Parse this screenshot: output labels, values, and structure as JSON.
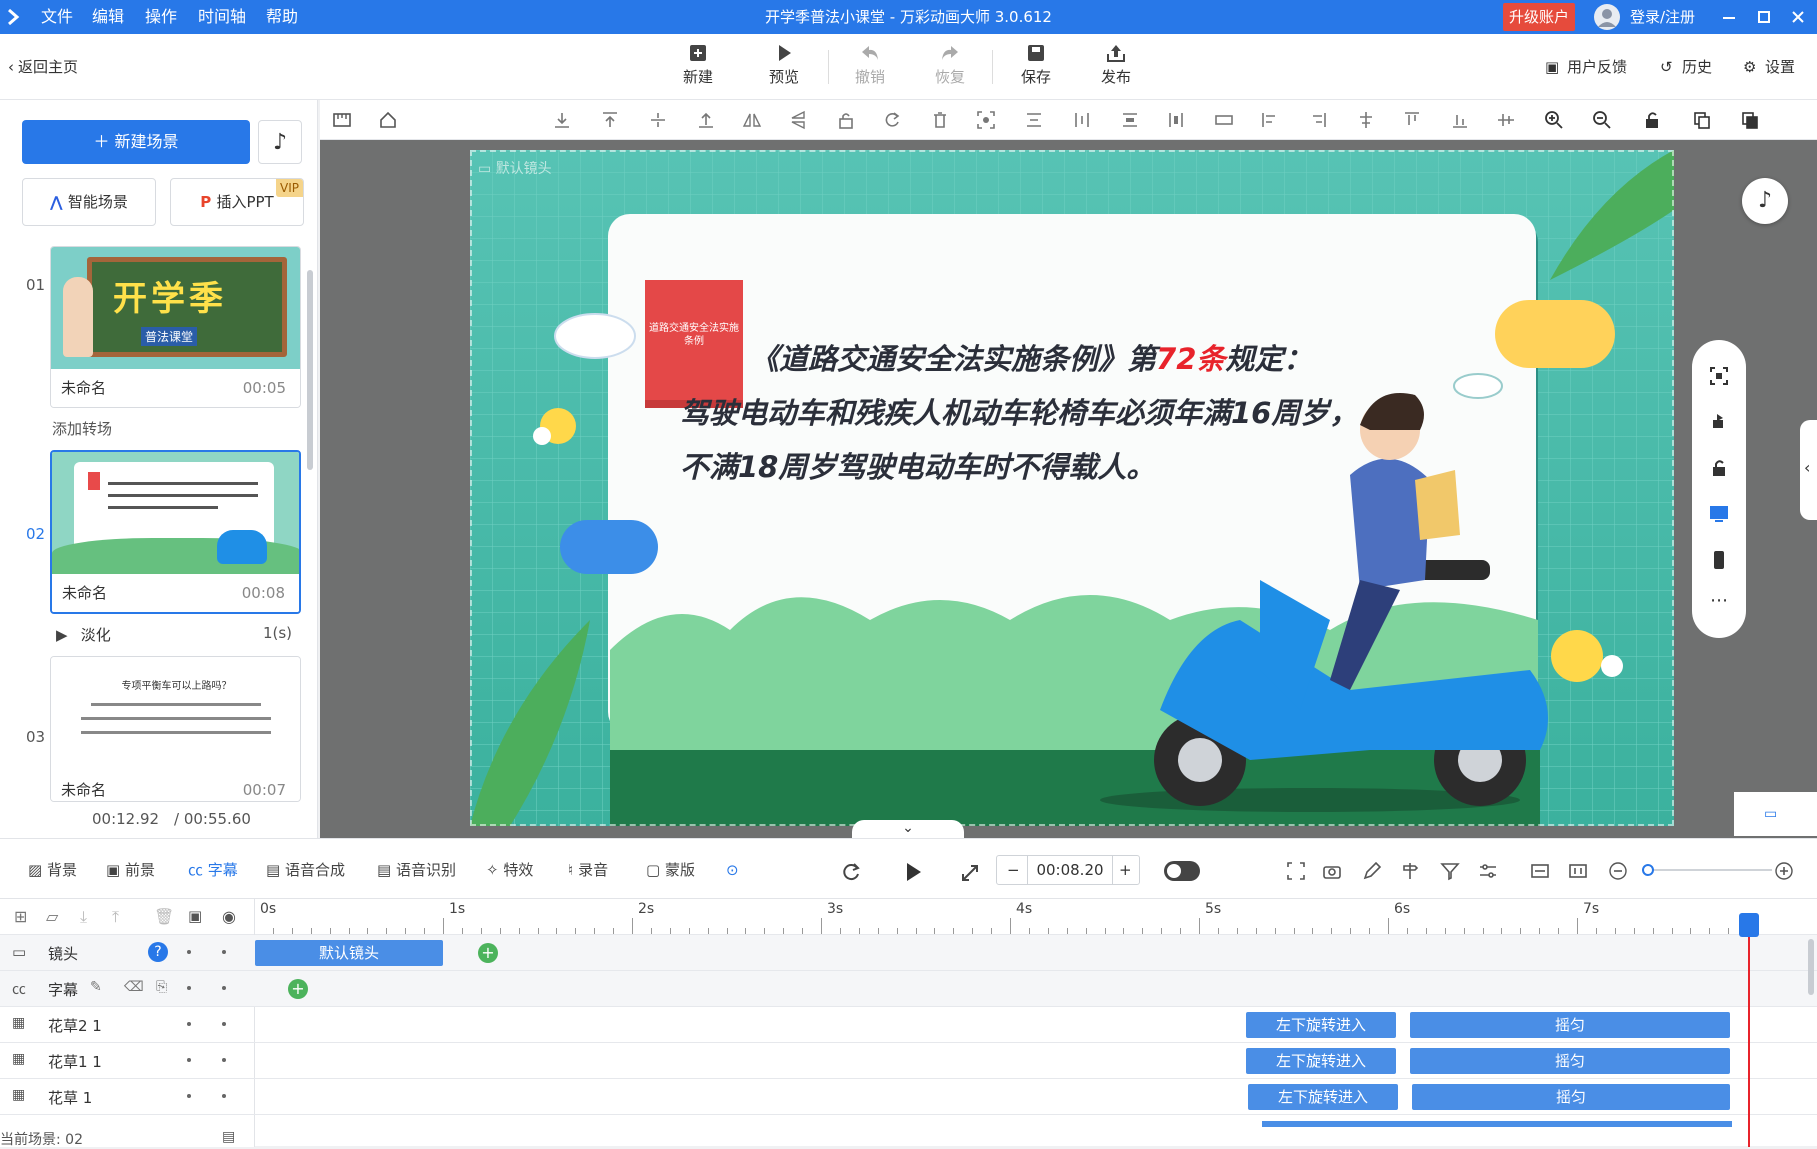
{
  "app": {
    "title": "开学季普法小课堂 - 万彩动画大师 3.0.612",
    "menu": [
      "文件",
      "编辑",
      "操作",
      "时间轴",
      "帮助"
    ],
    "upgrade": "升级账户",
    "login": "登录/注册"
  },
  "toolbar": {
    "back": "返回主页",
    "new": "新建",
    "preview": "预览",
    "undo": "撤销",
    "redo": "恢复",
    "save": "保存",
    "publish": "发布",
    "feedback": "用户反馈",
    "history": "历史",
    "settings": "设置"
  },
  "left": {
    "new_scene": "新建场景",
    "smart_scene": "智能场景",
    "insert_ppt": "插入PPT",
    "vip": "VIP",
    "add_transition": "添加转场",
    "transition_name": "淡化",
    "transition_dur": "1(s)",
    "current_time": "00:12.92",
    "total_time": "/ 00:55.60",
    "scenes": [
      {
        "num": "01",
        "name": "未命名",
        "dur": "00:05",
        "thumb_text": "开学季",
        "thumb_sub": "普法课堂"
      },
      {
        "num": "02",
        "name": "未命名",
        "dur": "00:08"
      },
      {
        "num": "03",
        "name": "未命名",
        "dur": "00:07",
        "thumb_text": "专项平衡车可以上路吗？"
      }
    ]
  },
  "stage": {
    "camera_label": "默认镜头",
    "book_text": "道路交通安全法实施条例",
    "line1_pre": "《道路交通安全法实施条例》第",
    "line1_num": "72条",
    "line1_post": "规定：",
    "line2": "驾驶电动车和残疾人机动车轮椅车必须年满16周岁，",
    "line3": "不满18周岁驾驶电动车时不得载人。"
  },
  "bottombar": {
    "tabs": [
      "背景",
      "前景",
      "字幕",
      "语音合成",
      "语音识别",
      "特效",
      "录音",
      "蒙版"
    ],
    "time": "00:08.20",
    "minus": "−",
    "plus": "+"
  },
  "timeline": {
    "ruler": [
      "0s",
      "1s",
      "2s",
      "3s",
      "4s",
      "5s",
      "6s",
      "7s"
    ],
    "tracks": [
      {
        "name": "镜头",
        "blocks": [
          {
            "label": "默认镜头"
          }
        ]
      },
      {
        "name": "字幕",
        "blocks": []
      },
      {
        "name": "花草2 1",
        "blocks": [
          {
            "label": "左下旋转进入"
          },
          {
            "label": "摇匀"
          }
        ]
      },
      {
        "name": "花草1 1",
        "blocks": [
          {
            "label": "左下旋转进入"
          },
          {
            "label": "摇匀"
          }
        ]
      },
      {
        "name": "花草 1",
        "blocks": [
          {
            "label": "左下旋转进入"
          },
          {
            "label": "摇匀"
          }
        ]
      }
    ],
    "current_scene": "当前场景: 02"
  },
  "colors": {
    "brand": "#2878e8",
    "upgrade": "#e64b3c",
    "accent_red": "#e8232b",
    "block": "#4a8ee6"
  }
}
